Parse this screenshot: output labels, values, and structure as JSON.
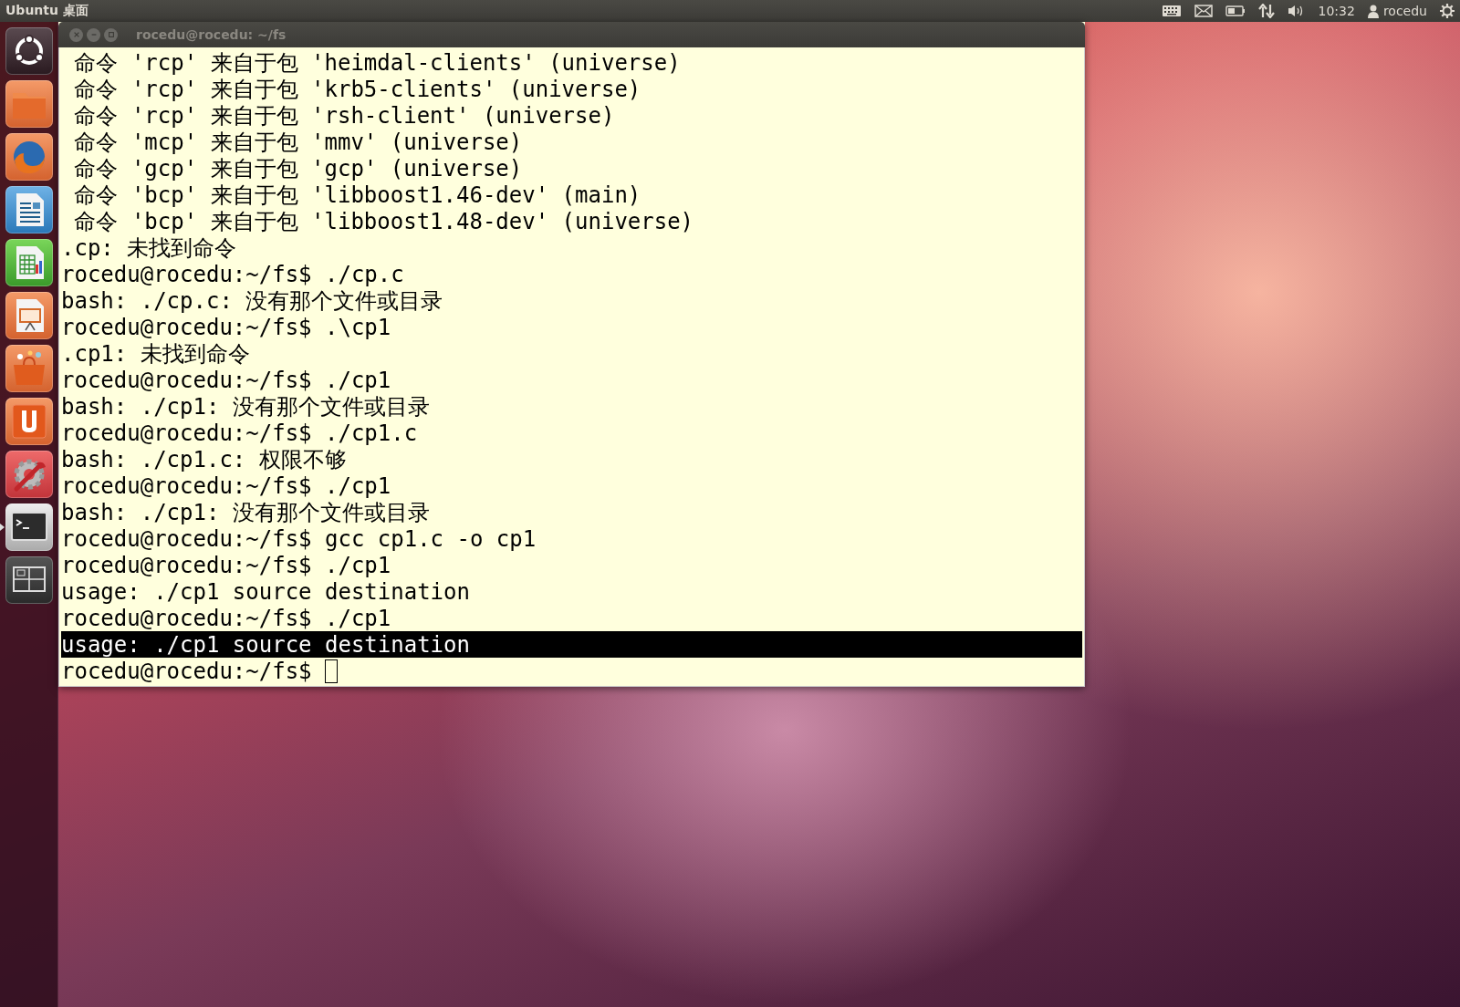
{
  "top_bar": {
    "title": "Ubuntu 桌面",
    "clock": "10:32",
    "user": "rocedu"
  },
  "launcher": [
    {
      "kind": "dash",
      "running": false
    },
    {
      "kind": "files",
      "running": false
    },
    {
      "kind": "browser",
      "running": false
    },
    {
      "kind": "writer",
      "running": false
    },
    {
      "kind": "calc",
      "running": false
    },
    {
      "kind": "impress",
      "running": false
    },
    {
      "kind": "software",
      "running": false
    },
    {
      "kind": "ubuntu-one",
      "running": false
    },
    {
      "kind": "settings",
      "running": false
    },
    {
      "kind": "terminal",
      "running": true
    },
    {
      "kind": "workspaces",
      "running": false
    }
  ],
  "terminal": {
    "title": "rocedu@rocedu: ~/fs",
    "lines": [
      {
        "text": " 命令 'rcp' 来自于包 'heimdal-clients' (universe)",
        "selected": false
      },
      {
        "text": " 命令 'rcp' 来自于包 'krb5-clients' (universe)",
        "selected": false
      },
      {
        "text": " 命令 'rcp' 来自于包 'rsh-client' (universe)",
        "selected": false
      },
      {
        "text": " 命令 'mcp' 来自于包 'mmv' (universe)",
        "selected": false
      },
      {
        "text": " 命令 'gcp' 来自于包 'gcp' (universe)",
        "selected": false
      },
      {
        "text": " 命令 'bcp' 来自于包 'libboost1.46-dev' (main)",
        "selected": false
      },
      {
        "text": " 命令 'bcp' 来自于包 'libboost1.48-dev' (universe)",
        "selected": false
      },
      {
        "text": ".cp: 未找到命令",
        "selected": false
      },
      {
        "text": "rocedu@rocedu:~/fs$ ./cp.c",
        "selected": false
      },
      {
        "text": "bash: ./cp.c: 没有那个文件或目录",
        "selected": false
      },
      {
        "text": "rocedu@rocedu:~/fs$ .\\cp1",
        "selected": false
      },
      {
        "text": ".cp1: 未找到命令",
        "selected": false
      },
      {
        "text": "rocedu@rocedu:~/fs$ ./cp1",
        "selected": false
      },
      {
        "text": "bash: ./cp1: 没有那个文件或目录",
        "selected": false
      },
      {
        "text": "rocedu@rocedu:~/fs$ ./cp1.c",
        "selected": false
      },
      {
        "text": "bash: ./cp1.c: 权限不够",
        "selected": false
      },
      {
        "text": "rocedu@rocedu:~/fs$ ./cp1",
        "selected": false
      },
      {
        "text": "bash: ./cp1: 没有那个文件或目录",
        "selected": false
      },
      {
        "text": "rocedu@rocedu:~/fs$ gcc cp1.c -o cp1",
        "selected": false
      },
      {
        "text": "rocedu@rocedu:~/fs$ ./cp1",
        "selected": false
      },
      {
        "text": "usage: ./cp1 source destination",
        "selected": false
      },
      {
        "text": "rocedu@rocedu:~/fs$ ./cp1",
        "selected": false
      },
      {
        "text": "usage: ./cp1 source destination",
        "selected": true
      },
      {
        "text": "rocedu@rocedu:~/fs$ ",
        "selected": false
      }
    ]
  }
}
